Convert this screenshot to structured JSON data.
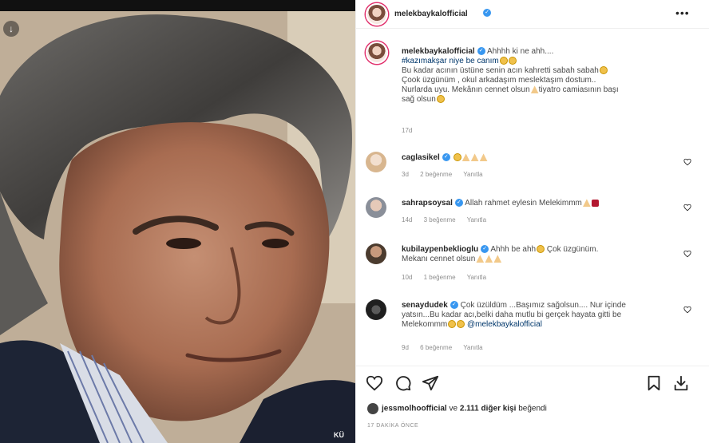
{
  "photo": {
    "watermark": "KÜ"
  },
  "post": {
    "username": "melekbaykalofficial",
    "more_icon": "more-horizontal-icon"
  },
  "caption": {
    "username": "melekbaykalofficial",
    "lines": [
      "Ahhhh ki ne ahh....",
      "#kazımakşar niye be canım",
      "Bu kadar acının üstüne senin acın kahretti sabah sabah",
      "Çook üzgünüm , okul arkadaşım meslektaşım dostum..",
      "Nurlarda uyu. Mekânın cennet olsun",
      "tiyatro camiasının başı",
      "sağ olsun"
    ],
    "age": "17d"
  },
  "comments": [
    {
      "username": "caglasikel",
      "text": "",
      "age": "3d",
      "likes": "2 beğenme",
      "reply": "Yanıtla"
    },
    {
      "username": "sahrapsoysal",
      "text": "Allah rahmet eylesin Melekimmm",
      "age": "14d",
      "likes": "3 beğenme",
      "reply": "Yanıtla"
    },
    {
      "username": "kubilaypenbeklioglu",
      "text": "Ahhh be ahh",
      "text2": "Çok üzgünüm.",
      "text3": "Mekanı cennet olsun",
      "age": "10d",
      "likes": "1 beğenme",
      "reply": "Yanıtla"
    },
    {
      "username": "senaydudek",
      "text": "Çok üzüldüm ...Başımız sağolsun.... Nur içinde",
      "text2": "yatsın...Bu kadar acı,belki daha mutlu bi gerçek hayata gitti be",
      "text3": "Melekommm",
      "mention": "@melekbaykalofficial",
      "age": "9d",
      "likes": "6 beğenme",
      "reply": "Yanıtla"
    }
  ],
  "likes_line": {
    "user": "jessmolhoofficial",
    "connector": "ve",
    "others": "2.111 diğer kişi",
    "suffix": "beğendi"
  },
  "timestamp": "17 DAKİKA ÖNCE",
  "colors": {
    "verified": "#3897f0",
    "text": "#262626",
    "muted": "#8e8e8e",
    "hashtag": "#00376b"
  }
}
